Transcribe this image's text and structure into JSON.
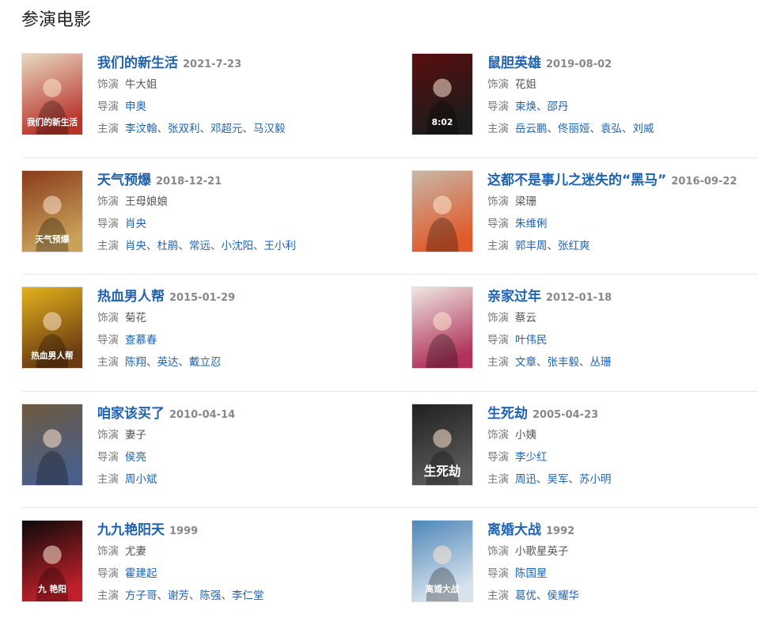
{
  "section_title": "参演电影",
  "labels": {
    "role": "饰演",
    "director": "导演",
    "cast": "主演"
  },
  "movies": [
    {
      "title": "我们的新生活",
      "date": "2021-7-23",
      "role": "牛大姐",
      "director": "申奥",
      "cast": [
        "李汶翰",
        "张双利",
        "邓超元",
        "马汉毅"
      ],
      "poster_colors": [
        "#e8d9c0",
        "#b8342b"
      ],
      "poster_text": "我们的新生活"
    },
    {
      "title": "鼠胆英雄",
      "date": "2019-08-02",
      "role": "花姐",
      "director": "束焕、邵丹",
      "cast": [
        "岳云鹏",
        "佟丽娅",
        "袁弘",
        "刘威"
      ],
      "poster_colors": [
        "#5b0d0d",
        "#1c1c1c"
      ],
      "poster_text": "8:02"
    },
    {
      "title": "天气预爆",
      "date": "2018-12-21",
      "role": "王母娘娘",
      "director": "肖央",
      "cast": [
        "肖央",
        "杜鹃",
        "常远",
        "小沈阳",
        "王小利"
      ],
      "poster_colors": [
        "#8a3a1a",
        "#c9a25a"
      ],
      "poster_text": "天气预爆"
    },
    {
      "title": "这都不是事儿之迷失的“黑马”",
      "date": "2016-09-22",
      "role": "梁珊",
      "director": "朱维俐",
      "cast": [
        "郭丰周",
        "张红爽"
      ],
      "poster_colors": [
        "#c7b7a8",
        "#e05a2a"
      ],
      "poster_text": ""
    },
    {
      "title": "热血男人帮",
      "date": "2015-01-29",
      "role": "菊花",
      "director": "查慕春",
      "cast": [
        "陈翔",
        "英达",
        "戴立忍"
      ],
      "poster_colors": [
        "#e2b21c",
        "#6b3b12"
      ],
      "poster_text": "热血男人帮"
    },
    {
      "title": "亲家过年",
      "date": "2012-01-18",
      "role": "蔡云",
      "director": "叶伟民",
      "cast": [
        "文章",
        "张丰毅",
        "丛珊"
      ],
      "poster_colors": [
        "#efe8e2",
        "#b0325a"
      ],
      "poster_text": ""
    },
    {
      "title": "咱家该买了",
      "date": "2010-04-14",
      "role": "妻子",
      "director": "侯亮",
      "cast": [
        "周小斌"
      ],
      "poster_colors": [
        "#6d5a3e",
        "#4a5f8a"
      ],
      "poster_text": ""
    },
    {
      "title": "生死劫",
      "date": "2005-04-23",
      "role": "小姨",
      "director": "李少红",
      "cast": [
        "周迅",
        "吴军",
        "苏小明"
      ],
      "poster_colors": [
        "#202020",
        "#5a5a5a"
      ],
      "poster_text": "生死劫"
    },
    {
      "title": "九九艳阳天",
      "date": "1999",
      "role": "尤妻",
      "director": "霍建起",
      "cast": [
        "方子哥",
        "谢芳",
        "陈强",
        "李仁堂"
      ],
      "poster_colors": [
        "#0a0a0a",
        "#c0202a"
      ],
      "poster_text": "九 艳阳"
    },
    {
      "title": "离婚大战",
      "date": "1992",
      "role": "小歌星英子",
      "director": "陈国星",
      "cast": [
        "葛优",
        "侯耀华"
      ],
      "poster_colors": [
        "#4d87b8",
        "#d8e3ee"
      ],
      "poster_text": "离婚大战"
    }
  ]
}
